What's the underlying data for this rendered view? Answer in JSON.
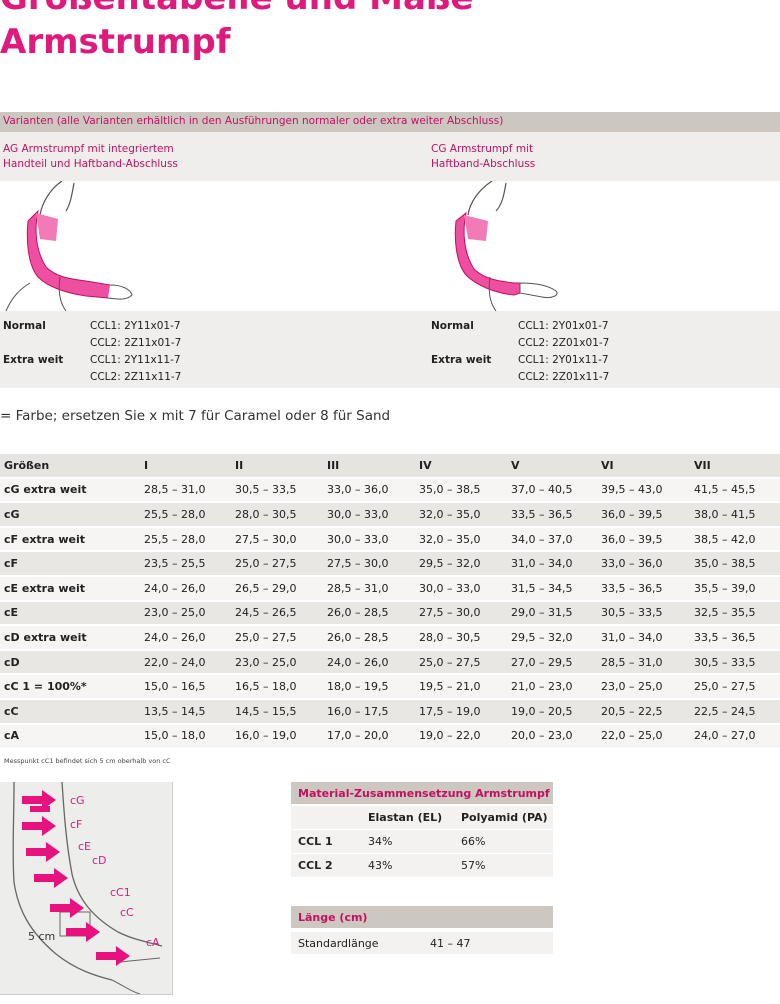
{
  "header": {
    "title_line1": "Größentabelle und Maße",
    "title_line2": "Armstrumpf"
  },
  "variants": {
    "heading": "Varianten (alle Varianten erhältlich in den Ausführungen normaler oder extra weiter Abschluss)",
    "ag": {
      "title_line1": "AG Armstrumpf mit integriertem",
      "title_line2": "Handteil und Haftband-Abschluss",
      "normal_label": "Normal",
      "normal_ccl1": "CCL1: 2Y11x01-7",
      "normal_ccl2": "CCL2: 2Z11x01-7",
      "extra_label": "Extra weit",
      "extra_ccl1": "CCL1: 2Y11x11-7",
      "extra_ccl2": "CCL2: 2Z11x11-7"
    },
    "cg": {
      "title_line1": "CG Armstrumpf mit",
      "title_line2": "Haftband-Abschluss",
      "normal_label": "Normal",
      "normal_ccl1": "CCL1: 2Y01x01-7",
      "normal_ccl2": "CCL2: 2Z01x01-7",
      "extra_label": "Extra weit",
      "extra_ccl1": "CCL1: 2Y01x11-7",
      "extra_ccl2": "CCL2: 2Z01x11-7"
    }
  },
  "color_note": "= Farbe; ersetzen Sie x mit 7 für Caramel oder 8 für Sand",
  "sizes": {
    "header": [
      "Größen",
      "I",
      "II",
      "III",
      "IV",
      "V",
      "VI",
      "VII"
    ],
    "rows": [
      {
        "label": "cG extra weit",
        "values": [
          "28,5 – 31,0",
          "30,5 – 33,5",
          "33,0 – 36,0",
          "35,0 – 38,5",
          "37,0 – 40,5",
          "39,5 – 43,0",
          "41,5 – 45,5"
        ]
      },
      {
        "label": "cG",
        "values": [
          "25,5 – 28,0",
          "28,0 – 30,5",
          "30,0 – 33,0",
          "32,0 – 35,0",
          "33,5 – 36,5",
          "36,0 – 39,5",
          "38,0 – 41,5"
        ]
      },
      {
        "label": "cF extra weit",
        "values": [
          "25,5 – 28,0",
          "27,5 – 30,0",
          "30,0 – 33,0",
          "32,0 – 35,0",
          "34,0 – 37,0",
          "36,0 – 39,5",
          "38,5 – 42,0"
        ]
      },
      {
        "label": "cF",
        "values": [
          "23,5 – 25,5",
          "25,0 – 27,5",
          "27,5 – 30,0",
          "29,5 – 32,0",
          "31,0 – 34,0",
          "33,0 – 36,0",
          "35,0 – 38,5"
        ]
      },
      {
        "label": "cE extra weit",
        "values": [
          "24,0 – 26,0",
          "26,5 – 29,0",
          "28,5 – 31,0",
          "30,0 – 33,0",
          "31,5 – 34,5",
          "33,5 – 36,5",
          "35,5 – 39,0"
        ]
      },
      {
        "label": "cE",
        "values": [
          "23,0 – 25,0",
          "24,5 – 26,5",
          "26,0 – 28,5",
          "27,5 – 30,0",
          "29,0 – 31,5",
          "30,5 – 33,5",
          "32,5 – 35,5"
        ]
      },
      {
        "label": "cD extra weit",
        "values": [
          "24,0 – 26,0",
          "25,0 – 27,5",
          "26,0 – 28,5",
          "28,0 – 30,5",
          "29,5 – 32,0",
          "31,0 – 34,0",
          "33,5 – 36,5"
        ]
      },
      {
        "label": "cD",
        "values": [
          "22,0 – 24,0",
          "23,0 – 25,0",
          "24,0 – 26,0",
          "25,0 – 27,5",
          "27,0 – 29,5",
          "28,5 – 31,0",
          "30,5 – 33,5"
        ]
      },
      {
        "label": "cC 1 = 100%*",
        "values": [
          "15,0 – 16,5",
          "16,5 – 18,0",
          "18,0 – 19,5",
          "19,5 – 21,0",
          "21,0 – 23,0",
          "23,0 – 25,0",
          "25,0 – 27,5"
        ]
      },
      {
        "label": "cC",
        "values": [
          "13,5 – 14,5",
          "14,5 – 15,5",
          "16,0 – 17,5",
          "17,5 – 19,0",
          "19,0 – 20,5",
          "20,5 – 22,5",
          "22,5 – 24,5"
        ]
      },
      {
        "label": "cA",
        "values": [
          "15,0 – 18,0",
          "16,0 – 19,0",
          "17,0 – 20,0",
          "19,0 – 22,0",
          "20,0 – 23,0",
          "22,0 – 25,0",
          "24,0 – 27,0"
        ]
      }
    ]
  },
  "footnote": "Messpunkt cC1 befindet sich 5 cm oberhalb von cC",
  "diagram": {
    "labels": [
      "cG",
      "cF",
      "cE",
      "cD",
      "cC1",
      "cC",
      "cA"
    ],
    "distance_label": "5 cm"
  },
  "material": {
    "title": "Material-Zusammensetzung Armstrumpf",
    "col1": "Elastan (EL)",
    "col2": "Polyamid (PA)",
    "rows": [
      {
        "label": "CCL 1",
        "el": "34%",
        "pa": "66%"
      },
      {
        "label": "CCL 2",
        "el": "43%",
        "pa": "57%"
      }
    ]
  },
  "length": {
    "title": "Länge (cm)",
    "label": "Standardlänge",
    "value": "41 – 47"
  },
  "colors": {
    "magenta": "#e0197d",
    "arrow": "#e8127e",
    "panel": "#efeeec",
    "header_band": "#cdc7c2"
  }
}
